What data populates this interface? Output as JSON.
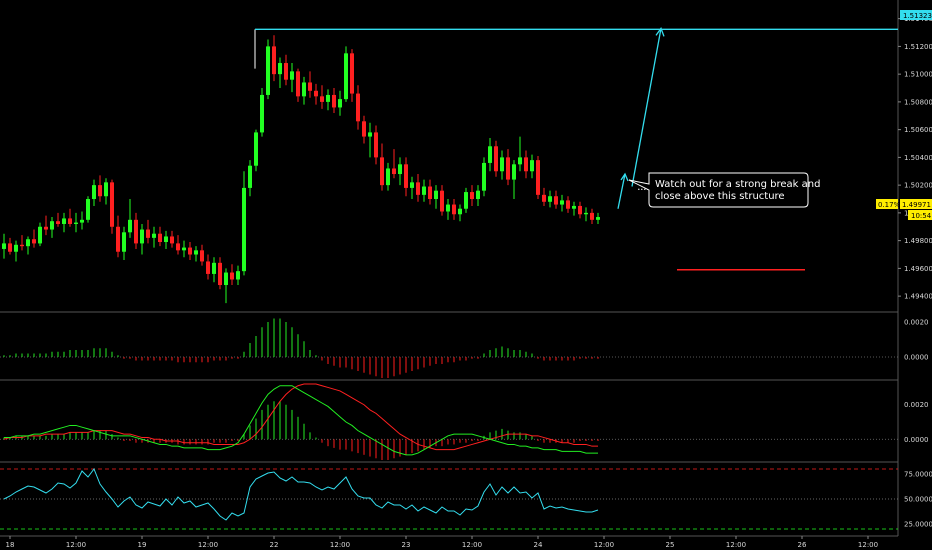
{
  "colors": {
    "background": "#000000",
    "bull": "#22ff22",
    "bear": "#ff2020",
    "cyan": "#33ddee",
    "hist_green": "#1ec51e",
    "hist_red": "#d41818",
    "signal_red": "#ff2020",
    "signal_green": "#22ee22",
    "rsi": "#33ddee",
    "price_tag": "#ffee00"
  },
  "annotations": {
    "note_line1": "Watch out for a strong break and",
    "note_line2": "close above this structure"
  },
  "price_axis": {
    "labels": [
      "1.51400",
      "1.51200",
      "1.51000",
      "1.50800",
      "1.50600",
      "1.50400",
      "1.50200",
      "1.50000",
      "1.49800",
      "1.49600",
      "1.49400"
    ],
    "level_tag": "1.51323",
    "last_tag_pct": "0.17%",
    "last_tag_price": "1.49971",
    "last_tag_time": "10:54"
  },
  "macd_axis": {
    "labels": [
      "0.0020",
      "0.0000"
    ]
  },
  "macd2_axis": {
    "labels": [
      "0.0020",
      "0.0000"
    ]
  },
  "rsi_axis": {
    "labels": [
      "75.0000",
      "50.0000",
      "25.0000"
    ]
  },
  "time_axis": {
    "labels": [
      "18",
      "12:00",
      "19",
      "12:00",
      "22",
      "12:00",
      "23",
      "12:00",
      "24",
      "12:00",
      "25",
      "12:00",
      "26",
      "12:00"
    ]
  },
  "chart_data": [
    {
      "type": "candlestick",
      "ylim": [
        1.493,
        1.5152
      ],
      "resistance_level": 1.51323,
      "last_price": 1.49971,
      "projection": {
        "from_x": 118,
        "from_y": 1.4998,
        "to_x": 128,
        "to_y": 1.5132
      },
      "structure_line": {
        "from_x": 106,
        "to_x": 125,
        "y": 1.5017
      },
      "support_line": {
        "from_x": 111,
        "to_x": 132,
        "y": 1.4959
      },
      "candles": [
        [
          1.4974,
          1.4985,
          1.4967,
          1.4978
        ],
        [
          1.4978,
          1.4982,
          1.497,
          1.4972
        ],
        [
          1.4972,
          1.498,
          1.4965,
          1.4977
        ],
        [
          1.4977,
          1.4984,
          1.4973,
          1.4976
        ],
        [
          1.4976,
          1.4983,
          1.497,
          1.4981
        ],
        [
          1.4981,
          1.4988,
          1.4975,
          1.4978
        ],
        [
          1.4978,
          1.4993,
          1.4976,
          1.499
        ],
        [
          1.499,
          1.4998,
          1.4984,
          1.4988
        ],
        [
          1.4988,
          1.4997,
          1.4982,
          1.4994
        ],
        [
          1.4994,
          1.5,
          1.499,
          1.4992
        ],
        [
          1.4992,
          1.5,
          1.4986,
          1.4996
        ],
        [
          1.4996,
          1.5003,
          1.499,
          1.4992
        ],
        [
          1.4992,
          1.5,
          1.4986,
          1.4993
        ],
        [
          1.4993,
          1.5001,
          1.4988,
          1.4995
        ],
        [
          1.4995,
          1.5012,
          1.4993,
          1.501
        ],
        [
          1.501,
          1.5024,
          1.5005,
          1.502
        ],
        [
          1.502,
          1.5027,
          1.5008,
          1.5012
        ],
        [
          1.5012,
          1.5025,
          1.5006,
          1.5022
        ],
        [
          1.5022,
          1.5024,
          1.4985,
          1.499
        ],
        [
          1.499,
          1.4998,
          1.4968,
          1.4972
        ],
        [
          1.4972,
          1.499,
          1.4966,
          1.4986
        ],
        [
          1.4986,
          1.501,
          1.4982,
          1.4995
        ],
        [
          1.4995,
          1.5,
          1.4974,
          1.4978
        ],
        [
          1.4978,
          1.4992,
          1.497,
          1.4988
        ],
        [
          1.4988,
          1.4995,
          1.4978,
          1.4982
        ],
        [
          1.4982,
          1.499,
          1.4975,
          1.4985
        ],
        [
          1.4985,
          1.499,
          1.4976,
          1.4979
        ],
        [
          1.4979,
          1.4987,
          1.4974,
          1.4983
        ],
        [
          1.4983,
          1.4987,
          1.4975,
          1.4978
        ],
        [
          1.4978,
          1.4984,
          1.497,
          1.4973
        ],
        [
          1.4973,
          1.498,
          1.4968,
          1.4975
        ],
        [
          1.4975,
          1.4979,
          1.4966,
          1.497
        ],
        [
          1.497,
          1.4976,
          1.4965,
          1.4973
        ],
        [
          1.4973,
          1.4977,
          1.4962,
          1.4965
        ],
        [
          1.4965,
          1.497,
          1.4952,
          1.4956
        ],
        [
          1.4956,
          1.4968,
          1.495,
          1.4964
        ],
        [
          1.4964,
          1.4968,
          1.4945,
          1.4948
        ],
        [
          1.4948,
          1.496,
          1.4935,
          1.4957
        ],
        [
          1.4957,
          1.4963,
          1.4948,
          1.4952
        ],
        [
          1.4952,
          1.4962,
          1.4948,
          1.4958
        ],
        [
          1.4958,
          1.503,
          1.4955,
          1.5018
        ],
        [
          1.5018,
          1.5038,
          1.5012,
          1.5034
        ],
        [
          1.5034,
          1.506,
          1.503,
          1.5058
        ],
        [
          1.5058,
          1.509,
          1.5055,
          1.5085
        ],
        [
          1.5085,
          1.5125,
          1.5082,
          1.512
        ],
        [
          1.512,
          1.5128,
          1.5095,
          1.51
        ],
        [
          1.51,
          1.5112,
          1.509,
          1.5108
        ],
        [
          1.5108,
          1.5114,
          1.5092,
          1.5096
        ],
        [
          1.5096,
          1.5108,
          1.5087,
          1.5102
        ],
        [
          1.5102,
          1.5104,
          1.508,
          1.5084
        ],
        [
          1.5084,
          1.5098,
          1.5078,
          1.5094
        ],
        [
          1.5094,
          1.5102,
          1.5083,
          1.5088
        ],
        [
          1.5088,
          1.5093,
          1.5078,
          1.5084
        ],
        [
          1.5084,
          1.5092,
          1.5075,
          1.508
        ],
        [
          1.508,
          1.5089,
          1.5074,
          1.5085
        ],
        [
          1.5085,
          1.509,
          1.5072,
          1.5076
        ],
        [
          1.5076,
          1.5088,
          1.507,
          1.5082
        ],
        [
          1.5082,
          1.512,
          1.508,
          1.5115
        ],
        [
          1.5115,
          1.5118,
          1.508,
          1.5086
        ],
        [
          1.5086,
          1.5092,
          1.506,
          1.5066
        ],
        [
          1.5066,
          1.507,
          1.505,
          1.5055
        ],
        [
          1.5055,
          1.5065,
          1.504,
          1.5058
        ],
        [
          1.5058,
          1.5063,
          1.5035,
          1.504
        ],
        [
          1.504,
          1.505,
          1.5016,
          1.502
        ],
        [
          1.502,
          1.5036,
          1.5016,
          1.5032
        ],
        [
          1.5032,
          1.5046,
          1.5025,
          1.5028
        ],
        [
          1.5028,
          1.504,
          1.502,
          1.5035
        ],
        [
          1.5035,
          1.504,
          1.5012,
          1.5018
        ],
        [
          1.5018,
          1.5026,
          1.501,
          1.5022
        ],
        [
          1.5022,
          1.5028,
          1.5008,
          1.5013
        ],
        [
          1.5013,
          1.5024,
          1.5008,
          1.5019
        ],
        [
          1.5019,
          1.5024,
          1.5006,
          1.501
        ],
        [
          1.501,
          1.502,
          1.5003,
          1.5016
        ],
        [
          1.5016,
          1.502,
          1.4998,
          1.5001
        ],
        [
          1.5001,
          1.501,
          1.4995,
          1.5006
        ],
        [
          1.5006,
          1.501,
          1.4995,
          1.4999
        ],
        [
          1.4999,
          1.5006,
          1.4994,
          1.5003
        ],
        [
          1.5003,
          1.5018,
          1.5,
          1.5015
        ],
        [
          1.5015,
          1.502,
          1.5005,
          1.501
        ],
        [
          1.501,
          1.502,
          1.5005,
          1.5016
        ],
        [
          1.5016,
          1.504,
          1.5012,
          1.5036
        ],
        [
          1.5036,
          1.5054,
          1.503,
          1.5048
        ],
        [
          1.5048,
          1.5052,
          1.5026,
          1.503
        ],
        [
          1.503,
          1.5045,
          1.5024,
          1.504
        ],
        [
          1.504,
          1.5046,
          1.502,
          1.5024
        ],
        [
          1.5024,
          1.5038,
          1.501,
          1.5035
        ],
        [
          1.5035,
          1.5055,
          1.503,
          1.504
        ],
        [
          1.504,
          1.5045,
          1.5025,
          1.503
        ],
        [
          1.503,
          1.5042,
          1.5025,
          1.5038
        ],
        [
          1.5038,
          1.5041,
          1.501,
          1.5013
        ],
        [
          1.5013,
          1.5018,
          1.5005,
          1.5008
        ],
        [
          1.5008,
          1.5016,
          1.5004,
          1.5012
        ],
        [
          1.5012,
          1.5016,
          1.5003,
          1.5006
        ],
        [
          1.5006,
          1.5013,
          1.5001,
          1.5009
        ],
        [
          1.5009,
          1.5012,
          1.5,
          1.5003
        ],
        [
          1.5003,
          1.5008,
          1.4998,
          1.5005
        ],
        [
          1.5005,
          1.5008,
          1.4996,
          1.4999
        ],
        [
          1.4999,
          1.5004,
          1.4994,
          1.5
        ],
        [
          1.5,
          1.5003,
          1.4992,
          1.4995
        ],
        [
          1.4995,
          1.5,
          1.4992,
          1.4997
        ]
      ]
    },
    {
      "type": "bar",
      "ylim": [
        -0.0012,
        0.0024
      ],
      "values": [
        0.0001,
        0.0001,
        0.0002,
        0.0002,
        0.0002,
        0.0002,
        0.0002,
        0.0002,
        0.0003,
        0.0003,
        0.0003,
        0.0004,
        0.0004,
        0.0004,
        0.0004,
        0.0005,
        0.0005,
        0.0005,
        0.0003,
        0.0001,
        -0.0001,
        -0.0001,
        -0.0002,
        -0.0002,
        -0.0002,
        -0.0002,
        -0.0002,
        -0.0002,
        -0.0002,
        -0.0003,
        -0.0003,
        -0.0003,
        -0.0003,
        -0.0003,
        -0.0003,
        -0.0002,
        -0.0002,
        -0.0002,
        -0.0001,
        -0.0001,
        0.0003,
        0.0008,
        0.0012,
        0.0017,
        0.002,
        0.0022,
        0.0022,
        0.002,
        0.0017,
        0.0013,
        0.0009,
        0.0004,
        0.0001,
        -0.0002,
        -0.0004,
        -0.0005,
        -0.0006,
        -0.0006,
        -0.0007,
        -0.0008,
        -0.0009,
        -0.001,
        -0.0011,
        -0.0012,
        -0.0012,
        -0.0011,
        -0.001,
        -0.0009,
        -0.0008,
        -0.0007,
        -0.0006,
        -0.0005,
        -0.0004,
        -0.0004,
        -0.0003,
        -0.0003,
        -0.0002,
        -0.0002,
        -0.0001,
        -0.0001,
        0.0002,
        0.0004,
        0.0005,
        0.0006,
        0.0005,
        0.0004,
        0.0004,
        0.0003,
        0.0002,
        -0.0001,
        -0.0002,
        -0.0002,
        -0.0002,
        -0.0002,
        -0.0002,
        -0.0002,
        -0.0001,
        -0.0001,
        -0.0001,
        -0.0001
      ]
    },
    {
      "type": "bar",
      "ylim": [
        -0.0012,
        0.0032
      ],
      "values": [
        0.0001,
        0.0001,
        0.0002,
        0.0002,
        0.0002,
        0.0002,
        0.0002,
        0.0002,
        0.0003,
        0.0003,
        0.0003,
        0.0004,
        0.0004,
        0.0004,
        0.0004,
        0.0005,
        0.0005,
        0.0005,
        0.0003,
        0.0001,
        -0.0001,
        -0.0001,
        -0.0002,
        -0.0002,
        -0.0002,
        -0.0002,
        -0.0002,
        -0.0002,
        -0.0002,
        -0.0003,
        -0.0003,
        -0.0003,
        -0.0003,
        -0.0003,
        -0.0003,
        -0.0002,
        -0.0002,
        -0.0002,
        -0.0001,
        -0.0001,
        0.0003,
        0.0008,
        0.0012,
        0.0017,
        0.002,
        0.0022,
        0.0022,
        0.002,
        0.0017,
        0.0013,
        0.0009,
        0.0004,
        0.0001,
        -0.0002,
        -0.0004,
        -0.0005,
        -0.0006,
        -0.0006,
        -0.0007,
        -0.0008,
        -0.0009,
        -0.001,
        -0.0011,
        -0.0012,
        -0.0012,
        -0.0011,
        -0.001,
        -0.0009,
        -0.0008,
        -0.0007,
        -0.0006,
        -0.0005,
        -0.0004,
        -0.0004,
        -0.0003,
        -0.0003,
        -0.0002,
        -0.0002,
        -0.0001,
        -0.0001,
        0.0002,
        0.0004,
        0.0005,
        0.0006,
        0.0005,
        0.0004,
        0.0004,
        0.0003,
        0.0002,
        -0.0001,
        -0.0002,
        -0.0002,
        -0.0002,
        -0.0002,
        -0.0002,
        -0.0002,
        -0.0001,
        -0.0001,
        -0.0001,
        -0.0001
      ],
      "signal_red": [
        0.0,
        0.0001,
        0.0001,
        0.0001,
        0.0002,
        0.0002,
        0.0002,
        0.0003,
        0.0003,
        0.0003,
        0.0003,
        0.0004,
        0.0004,
        0.0004,
        0.0004,
        0.0005,
        0.0005,
        0.0005,
        0.0005,
        0.0004,
        0.0003,
        0.0003,
        0.0002,
        0.0001,
        0.0001,
        0.0,
        0.0,
        -0.0001,
        -0.0001,
        -0.0001,
        -0.0002,
        -0.0002,
        -0.0002,
        -0.0002,
        -0.0002,
        -0.0003,
        -0.0003,
        -0.0003,
        -0.0003,
        -0.0003,
        -0.0002,
        0.0,
        0.0003,
        0.0007,
        0.0012,
        0.0017,
        0.0022,
        0.0026,
        0.0029,
        0.0031,
        0.0032,
        0.0032,
        0.0032,
        0.0031,
        0.003,
        0.0029,
        0.0028,
        0.0026,
        0.0024,
        0.0022,
        0.002,
        0.0017,
        0.0015,
        0.0012,
        0.0009,
        0.0006,
        0.0003,
        0.0001,
        -0.0001,
        -0.0003,
        -0.0004,
        -0.0005,
        -0.0006,
        -0.0006,
        -0.0006,
        -0.0006,
        -0.0005,
        -0.0004,
        -0.0003,
        -0.0002,
        -0.0001,
        0.0,
        0.0001,
        0.0002,
        0.0003,
        0.0003,
        0.0003,
        0.0003,
        0.0002,
        0.0002,
        0.0001,
        0.0,
        -0.0001,
        -0.0002,
        -0.0002,
        -0.0003,
        -0.0003,
        -0.0003,
        -0.0004,
        -0.0004
      ],
      "signal_green": [
        0.0001,
        0.0001,
        0.0002,
        0.0002,
        0.0002,
        0.0003,
        0.0003,
        0.0004,
        0.0005,
        0.0006,
        0.0007,
        0.0008,
        0.0008,
        0.0007,
        0.0006,
        0.0005,
        0.0004,
        0.0003,
        0.0002,
        0.0002,
        0.0002,
        0.0002,
        0.0001,
        0.0,
        -0.0001,
        -0.0002,
        -0.0003,
        -0.0003,
        -0.0004,
        -0.0004,
        -0.0005,
        -0.0005,
        -0.0005,
        -0.0005,
        -0.0006,
        -0.0006,
        -0.0006,
        -0.0005,
        -0.0004,
        -0.0002,
        0.0003,
        0.0009,
        0.0015,
        0.0021,
        0.0026,
        0.0029,
        0.0031,
        0.0031,
        0.0031,
        0.0029,
        0.0027,
        0.0025,
        0.0023,
        0.0021,
        0.0019,
        0.0016,
        0.0013,
        0.001,
        0.0008,
        0.0005,
        0.0003,
        0.0001,
        -0.0001,
        -0.0003,
        -0.0005,
        -0.0007,
        -0.0008,
        -0.0009,
        -0.0009,
        -0.0008,
        -0.0006,
        -0.0004,
        -0.0002,
        0.0,
        0.0002,
        0.0003,
        0.0003,
        0.0003,
        0.0003,
        0.0002,
        0.0001,
        0.0,
        -0.0001,
        -0.0002,
        -0.0003,
        -0.0003,
        -0.0004,
        -0.0004,
        -0.0005,
        -0.0005,
        -0.0006,
        -0.0006,
        -0.0006,
        -0.0007,
        -0.0007,
        -0.0007,
        -0.0007,
        -0.0008,
        -0.0008,
        -0.0008
      ]
    },
    {
      "type": "line",
      "ylim": [
        15,
        85
      ],
      "levels": [
        80,
        50,
        20
      ],
      "values": [
        50,
        53,
        57,
        60,
        63,
        62,
        59,
        56,
        60,
        66,
        65,
        61,
        66,
        78,
        72,
        80,
        65,
        57,
        50,
        42,
        48,
        52,
        44,
        41,
        47,
        45,
        43,
        50,
        44,
        52,
        46,
        48,
        42,
        44,
        46,
        40,
        33,
        29,
        36,
        33,
        36,
        62,
        70,
        73,
        76,
        77,
        71,
        68,
        72,
        67,
        67,
        66,
        62,
        59,
        62,
        60,
        66,
        72,
        60,
        53,
        51,
        51,
        44,
        41,
        47,
        44,
        44,
        40,
        44,
        38,
        42,
        39,
        36,
        42,
        38,
        38,
        34,
        40,
        39,
        43,
        57,
        65,
        54,
        62,
        56,
        62,
        56,
        57,
        51,
        56,
        40,
        43,
        41,
        42,
        40,
        39,
        38,
        37,
        37,
        39
      ]
    }
  ]
}
